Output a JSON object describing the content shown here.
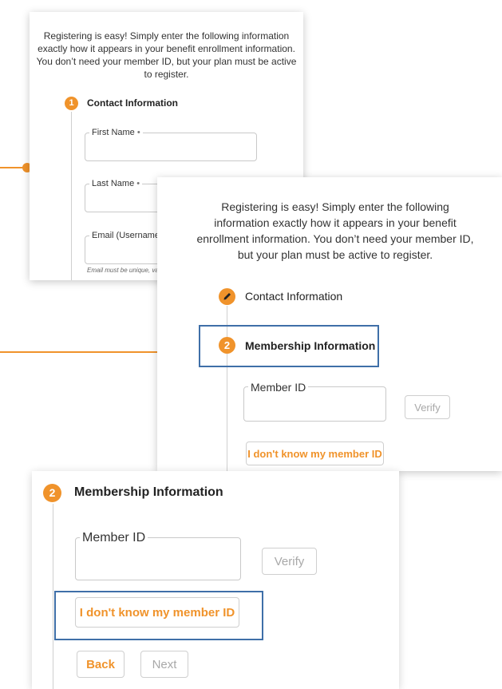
{
  "intro_text": "Registering is easy! Simply enter the following information exactly how it appears in your benefit enrollment information. You don’t need your member ID, but your plan must be active to register.",
  "card1": {
    "step_number": "1",
    "step_title": "Contact Information",
    "fields": {
      "first_name": "First Name",
      "last_name": "Last Name",
      "email": "Email (Username)"
    },
    "required_mark": "•",
    "email_hint": "Email must be unique, vali"
  },
  "card2": {
    "step1_title": "Contact Information",
    "step2_number": "2",
    "step2_title": "Membership Information",
    "member_id_label": "Member ID",
    "verify_label": "Verify",
    "dont_know_label": "I don't know my member ID"
  },
  "card3": {
    "step_number": "2",
    "step_title": "Membership Information",
    "member_id_label": "Member ID",
    "verify_label": "Verify",
    "dont_know_label": "I don't know my member ID",
    "back_label": "Back",
    "next_label": "Next"
  },
  "colors": {
    "accent": "#f0932b",
    "highlight": "#3f6fa8"
  },
  "icons": {
    "completed_step": "pencil-icon"
  }
}
